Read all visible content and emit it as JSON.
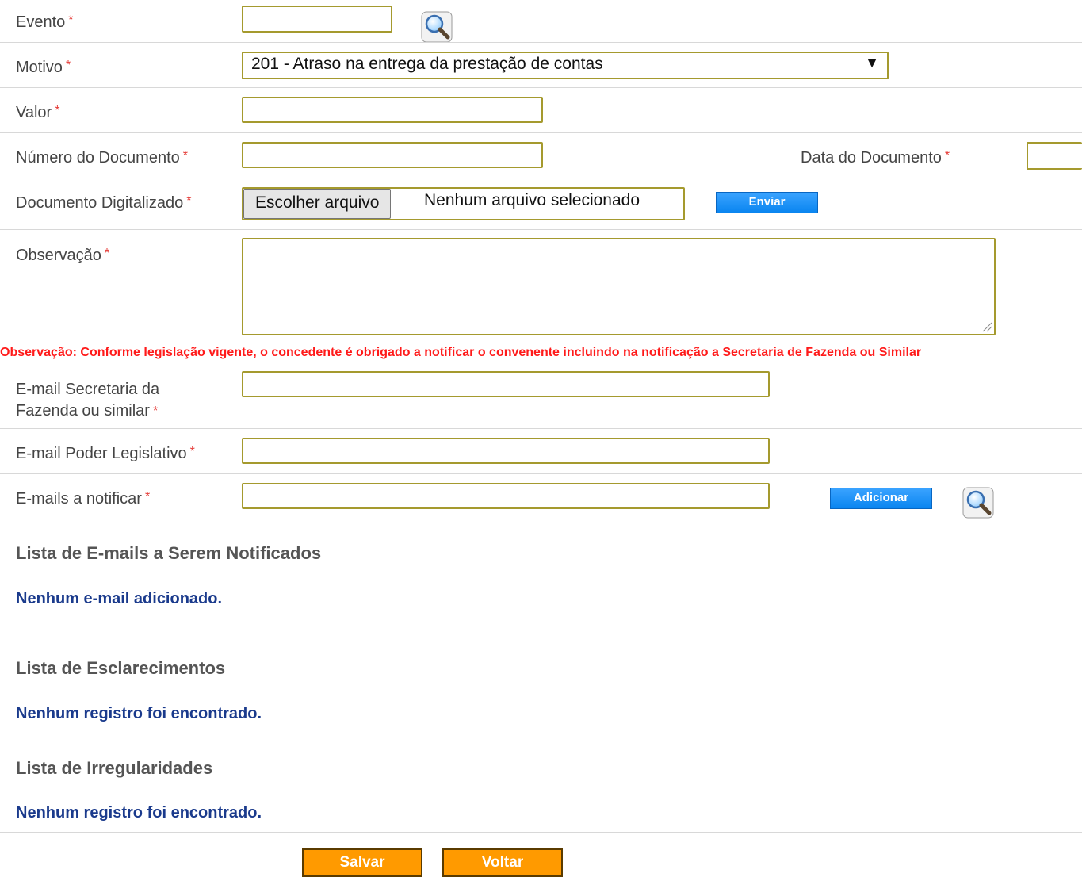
{
  "form": {
    "evento": {
      "label": "Evento",
      "value": ""
    },
    "motivo": {
      "label": "Motivo",
      "selected": "201 - Atraso na entrega da prestação de contas"
    },
    "valor": {
      "label": "Valor",
      "value": ""
    },
    "numero_documento": {
      "label": "Número do Documento",
      "value": ""
    },
    "data_documento": {
      "label": "Data do Documento",
      "value": ""
    },
    "documento_digitalizado": {
      "label": "Documento Digitalizado",
      "choose_label": "Escolher arquivo",
      "no_file_text": "Nenhum arquivo selecionado",
      "send_label": "Enviar"
    },
    "observacao": {
      "label": "Observação",
      "value": ""
    },
    "note": "Observação: Conforme legislação vigente, o concedente é obrigado a notificar o convenente incluindo na notificação a Secretaria de Fazenda ou Similar",
    "email_fazenda": {
      "label_line1": "E-mail Secretaria da",
      "label_line2": "Fazenda ou similar",
      "value": ""
    },
    "email_legislativo": {
      "label": "E-mail Poder Legislativo",
      "value": ""
    },
    "emails_notificar": {
      "label": "E-mails a notificar",
      "value": "",
      "add_label": "Adicionar"
    },
    "required_mark": "*"
  },
  "lists": {
    "emails": {
      "title": "Lista de E-mails a Serem Notificados",
      "empty": "Nenhum e-mail adicionado."
    },
    "esclarecimentos": {
      "title": "Lista de Esclarecimentos",
      "empty": "Nenhum registro foi encontrado."
    },
    "irregularidades": {
      "title": "Lista de Irregularidades",
      "empty": "Nenhum registro foi encontrado."
    }
  },
  "actions": {
    "save_label": "Salvar",
    "back_label": "Voltar"
  },
  "icons": {
    "search": "search-icon"
  },
  "colors": {
    "field_border": "#a59a2e",
    "required": "#e53935",
    "note": "#ff1a1a",
    "blue_button": "#0a85f0",
    "orange_button": "#ff9a00",
    "empty_message": "#1a3a8c"
  }
}
